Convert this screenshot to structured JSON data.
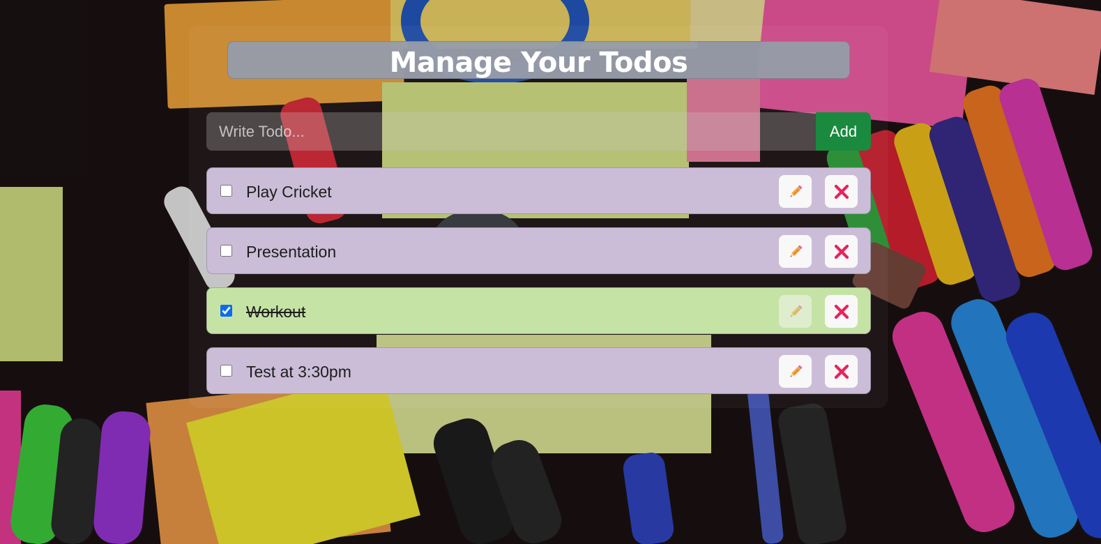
{
  "header": {
    "title": "Manage Your Todos"
  },
  "new_todo": {
    "placeholder": "Write Todo...",
    "value": "",
    "add_label": "Add"
  },
  "todos": [
    {
      "text": "Play Cricket",
      "completed": false
    },
    {
      "text": "Presentation",
      "completed": false
    },
    {
      "text": "Workout",
      "completed": true
    },
    {
      "text": "Test at 3:30pm",
      "completed": false
    }
  ],
  "icons": {
    "edit": "pencil-icon",
    "delete": "cross-mark-icon"
  },
  "colors": {
    "title_bar": "#969ca8",
    "add_button": "#198a3e",
    "todo_pending": "#cbbdd8",
    "todo_done": "#c6e3a6",
    "delete_cross": "#e6245a",
    "pencil": "#f0902a",
    "checkbox": "#0b6cf0"
  }
}
